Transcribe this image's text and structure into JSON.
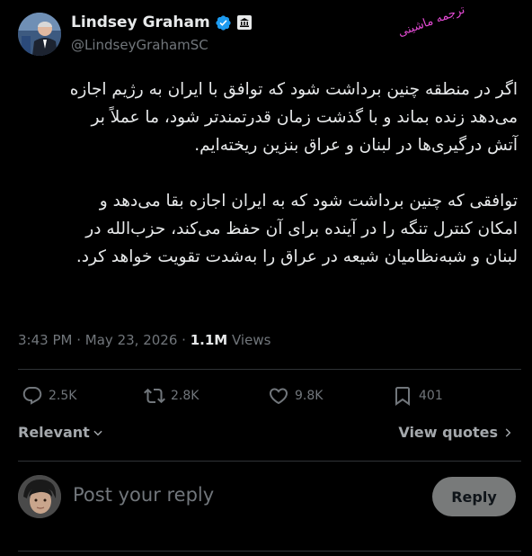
{
  "author": {
    "name": "Lindsey Graham",
    "handle": "@LindseyGrahamSC",
    "avatar_icon": "profile-photo",
    "verified_icon": "verified-badge-icon",
    "affiliation_icon": "government-building-icon"
  },
  "watermark": "ترجمه ماشینی",
  "tweet": {
    "paragraph1": [
      "اگر در منطقه چنین برداشت شود که توافق با ایران به رژیم اجازه",
      "می‌دهد زنده بماند و با گذشت زمان قدرتمندتر شود، ما عملاً بر",
      "آتش درگیری‌ها در لبنان و عراق بنزین ریخته‌ایم."
    ],
    "paragraph2": [
      "توافقی که چنین برداشت شود که به ایران اجازه بقا می‌دهد و",
      "امکان کنترل تنگه را در آینده برای آن حفظ می‌کند، حزب‌الله در",
      "لبنان و شبه‌نظامیان شیعه در عراق را به‌شدت تقویت خواهد کرد."
    ]
  },
  "meta": {
    "time": "3:43 PM",
    "separator": "·",
    "date": "May 23, 2026",
    "views_count": "1.1M",
    "views_label": "Views"
  },
  "actions": {
    "replies": "2.5K",
    "reposts": "2.8K",
    "likes": "9.8K",
    "bookmarks": "401"
  },
  "sort": {
    "label": "Relevant",
    "quotes_label": "View quotes"
  },
  "reply": {
    "placeholder": "Post your reply",
    "button_label": "Reply"
  },
  "colors": {
    "background": "#000000",
    "text_primary": "#e7e9ea",
    "text_secondary": "#71767b",
    "verified": "#1d9bf0",
    "divider": "#2f3336",
    "reply_button": "#787a7a",
    "watermark": "#e64bd6"
  }
}
